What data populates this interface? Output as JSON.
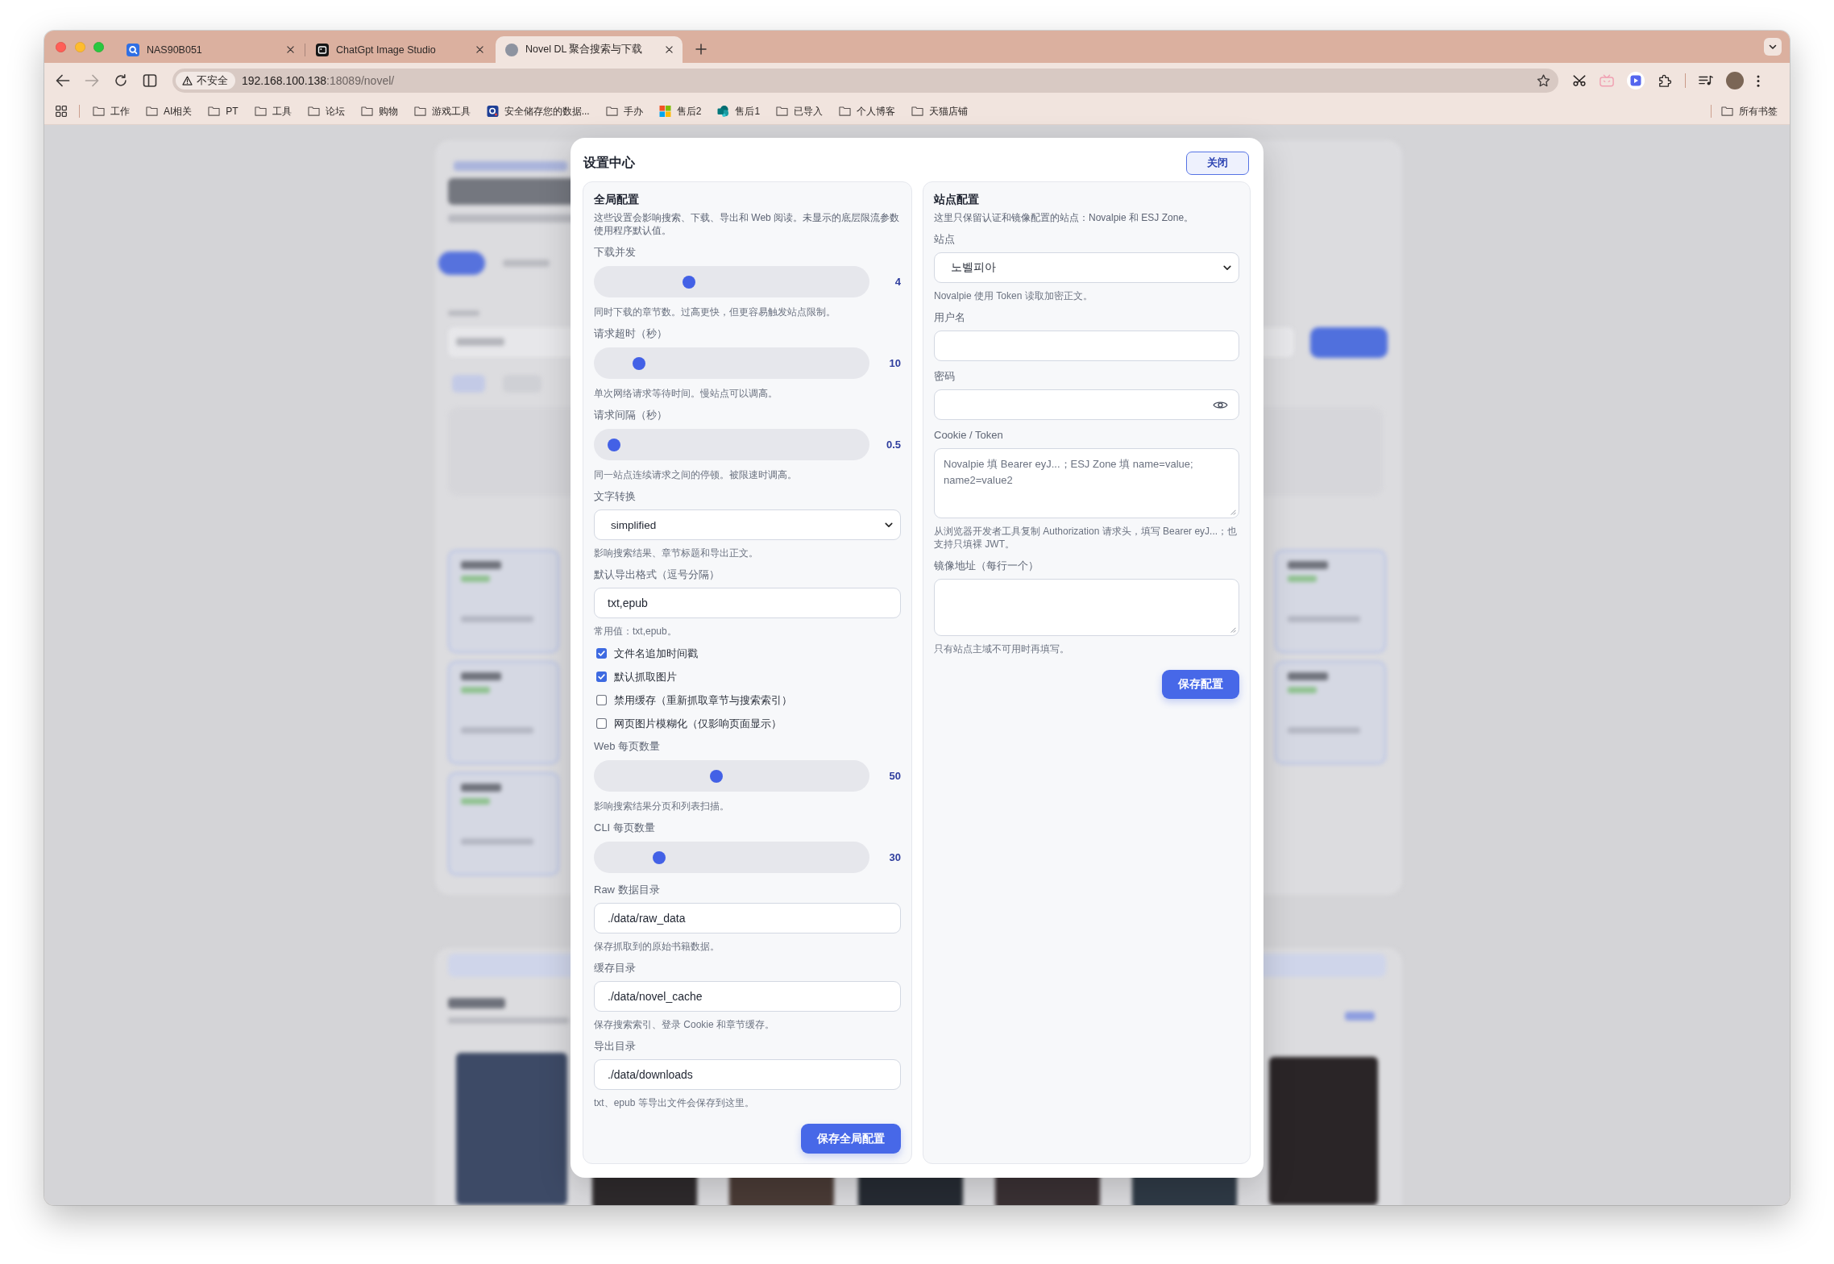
{
  "browser": {
    "tabs": [
      {
        "title": "NAS90B051",
        "selected": false
      },
      {
        "title": "ChatGpt Image Studio",
        "selected": false
      },
      {
        "title": "Novel DL 聚合搜索与下载",
        "selected": true
      }
    ],
    "forward_disabled": true,
    "address_bar": {
      "security_label": "不安全",
      "url_host": "192.168.100.138",
      "url_path": ":18089/novel/"
    },
    "bookmarks": [
      {
        "label": "工作",
        "kind": "folder"
      },
      {
        "label": "AI相关",
        "kind": "folder"
      },
      {
        "label": "PT",
        "kind": "folder"
      },
      {
        "label": "工具",
        "kind": "folder"
      },
      {
        "label": "论坛",
        "kind": "folder"
      },
      {
        "label": "购物",
        "kind": "folder"
      },
      {
        "label": "游戏工具",
        "kind": "folder"
      },
      {
        "label": "安全储存您的数据...",
        "kind": "link"
      },
      {
        "label": "手办",
        "kind": "folder"
      },
      {
        "label": "售后2",
        "kind": "link"
      },
      {
        "label": "售后1",
        "kind": "link"
      },
      {
        "label": "已导入",
        "kind": "folder"
      },
      {
        "label": "个人博客",
        "kind": "folder"
      },
      {
        "label": "天猫店铺",
        "kind": "folder"
      }
    ],
    "all_bookmarks": "所有书签"
  },
  "dialog": {
    "title": "设置中心",
    "close_button": "关闭",
    "global_settings": {
      "heading": "全局配置",
      "description": "这些设置会影响搜索、下载、导出和 Web 阅读。未显示的底层限流参数使用程序默认值。",
      "fields": [
        {
          "kind": "slider",
          "label": "下载并发",
          "level": 0.33,
          "reading": "4",
          "hint": "同时下载的章节数。过高更快，但更容易触发站点限制。"
        },
        {
          "kind": "slider",
          "label": "请求超时（秒）",
          "level": 0.13,
          "reading": "10",
          "hint": "单次网络请求等待时间。慢站点可以调高。"
        },
        {
          "kind": "slider",
          "label": "请求间隔（秒）",
          "level": 0.03,
          "reading": "0.5",
          "hint": "同一站点连续请求之间的停顿。被限速时调高。"
        },
        {
          "kind": "select",
          "label": "文字转换",
          "value": "simplified",
          "hint": "影响搜索结果、章节标题和导出正文。"
        },
        {
          "kind": "text",
          "label": "默认导出格式（逗号分隔）",
          "value": "txt,epub",
          "hint": "常用值：txt,epub。"
        },
        {
          "kind": "checkbox",
          "label": "文件名追加时间戳",
          "checked": true
        },
        {
          "kind": "checkbox",
          "label": "默认抓取图片",
          "checked": true
        },
        {
          "kind": "checkbox",
          "label": "禁用缓存（重新抓取章节与搜索索引）",
          "checked": false
        },
        {
          "kind": "checkbox",
          "label": "网页图片模糊化（仅影响页面显示）",
          "checked": false
        },
        {
          "kind": "slider",
          "label": "Web 每页数量",
          "level": 0.44,
          "reading": "50",
          "hint": "影响搜索结果分页和列表扫描。"
        },
        {
          "kind": "slider",
          "label": "CLI 每页数量",
          "level": 0.21,
          "reading": "30"
        },
        {
          "kind": "text",
          "label": "Raw 数据目录",
          "value": "./data/raw_data",
          "hint": "保存抓取到的原始书籍数据。"
        },
        {
          "kind": "text",
          "label": "缓存目录",
          "value": "./data/novel_cache",
          "hint": "保存搜索索引、登录 Cookie 和章节缓存。"
        },
        {
          "kind": "text",
          "label": "导出目录",
          "value": "./data/downloads",
          "hint": "txt、epub 等导出文件会保存到这里。"
        }
      ],
      "save_button": "保存全局配置"
    },
    "site_settings": {
      "heading": "站点配置",
      "description": "这里只保留认证和镜像配置的站点：Novalpie 和 ESJ Zone。",
      "fields": [
        {
          "kind": "select",
          "label": "站点",
          "value": "노벨피아",
          "hint": "Novalpie 使用 Token 读取加密正文。"
        },
        {
          "kind": "text",
          "label": "用户名"
        },
        {
          "kind": "password",
          "label": "密码"
        },
        {
          "kind": "textarea",
          "label": "Cookie / Token",
          "placeholder": "Novalpie 填 Bearer eyJ...；ESJ Zone 填 name=value; name2=value2",
          "hint": "从浏览器开发者工具复制 Authorization 请求头，填写 Bearer eyJ...；也支持只填裸 JWT。"
        },
        {
          "kind": "textarea",
          "label": "镜像地址（每行一个）",
          "hint": "只有站点主域不可用时再填写。"
        }
      ],
      "save_button": "保存配置"
    }
  }
}
